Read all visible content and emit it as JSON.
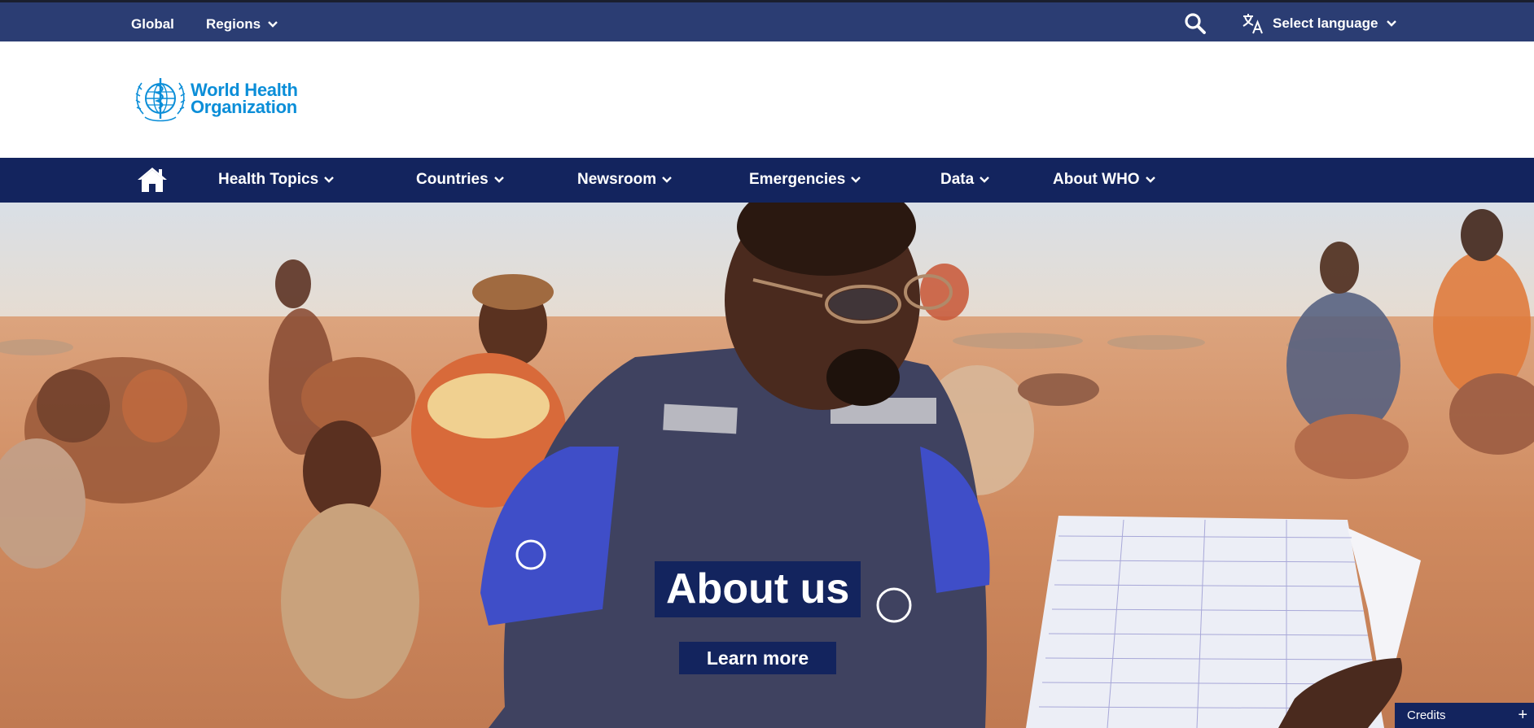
{
  "topbar": {
    "global_label": "Global",
    "regions_label": "Regions",
    "search_icon": "search-icon",
    "language_icon": "translate-icon",
    "language_label": "Select language"
  },
  "header": {
    "logo_line1": "World Health",
    "logo_line2": "Organization"
  },
  "nav": {
    "home_icon": "home-icon",
    "items": [
      {
        "label": "Health Topics"
      },
      {
        "label": "Countries"
      },
      {
        "label": "Newsroom"
      },
      {
        "label": "Emergencies"
      },
      {
        "label": "Data"
      },
      {
        "label": "About WHO"
      }
    ]
  },
  "hero": {
    "title": "About us",
    "button_label": "Learn more",
    "credits_label": "Credits",
    "credits_toggle": "+"
  },
  "colors": {
    "topbar_bg": "#2b3d73",
    "nav_bg": "#13245e",
    "logo_blue": "#0b8ed8",
    "button_bg": "#13245e"
  }
}
